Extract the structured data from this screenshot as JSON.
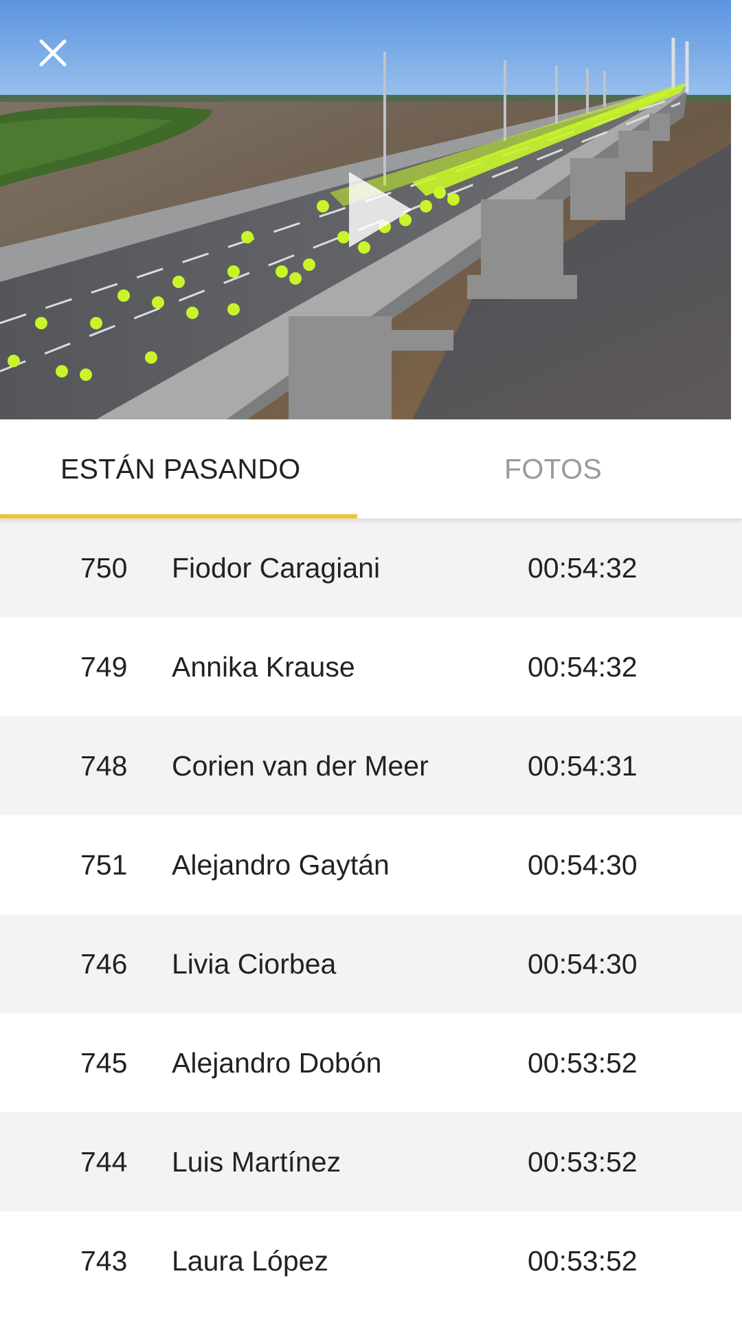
{
  "tabs": {
    "running_label": "ESTÁN PASANDO",
    "photos_label": "FOTOS"
  },
  "colors": {
    "accent": "#f2c230",
    "alt_row": "#f3f3f3",
    "inactive_tab": "#9a9a9a"
  },
  "icons": {
    "close": "close-icon",
    "play": "play-icon"
  },
  "runners": [
    {
      "number": "750",
      "name": "Fiodor Caragiani",
      "time": "00:54:32"
    },
    {
      "number": "749",
      "name": "Annika Krause",
      "time": "00:54:32"
    },
    {
      "number": "748",
      "name": "Corien van der Meer",
      "time": "00:54:31"
    },
    {
      "number": "751",
      "name": "Alejandro Gaytán",
      "time": "00:54:30"
    },
    {
      "number": "746",
      "name": "Livia Ciorbea",
      "time": "00:54:30"
    },
    {
      "number": "745",
      "name": "Alejandro Dobón",
      "time": "00:53:52"
    },
    {
      "number": "744",
      "name": "Luis Martínez",
      "time": "00:53:52"
    },
    {
      "number": "743",
      "name": "Laura López",
      "time": "00:53:52"
    }
  ]
}
